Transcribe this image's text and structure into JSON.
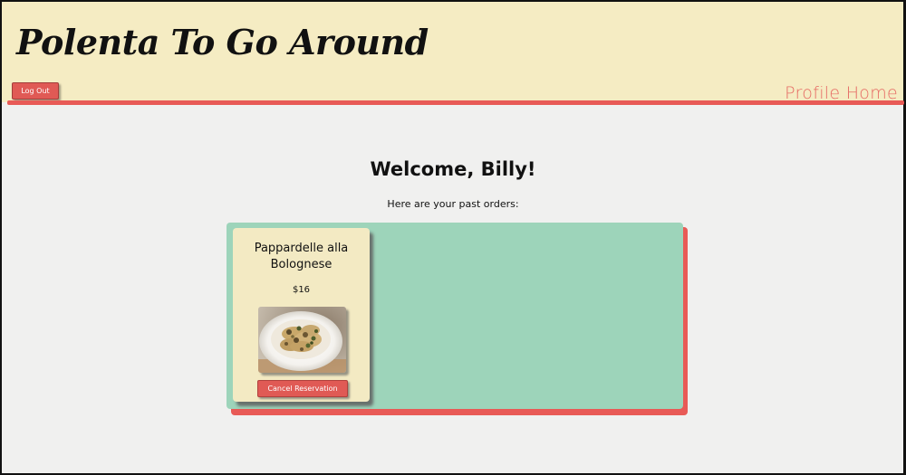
{
  "header": {
    "brand": "Polenta To Go Around",
    "logout_label": "Log Out",
    "profile_link": "Profile Home"
  },
  "main": {
    "welcome": "Welcome, Billy!",
    "subtitle": "Here are your past orders:",
    "orders": [
      {
        "name": "Pappardelle alla Bolognese",
        "price": "$16",
        "image": "pasta-dish-photo",
        "cancel_label": "Cancel Reservation"
      }
    ]
  },
  "colors": {
    "header_bg": "#f5ecc3",
    "accent_red": "#e85a56",
    "panel_green": "#9dd4ba",
    "card_bg": "#f3eac3",
    "page_bg": "#f0f0ef"
  }
}
